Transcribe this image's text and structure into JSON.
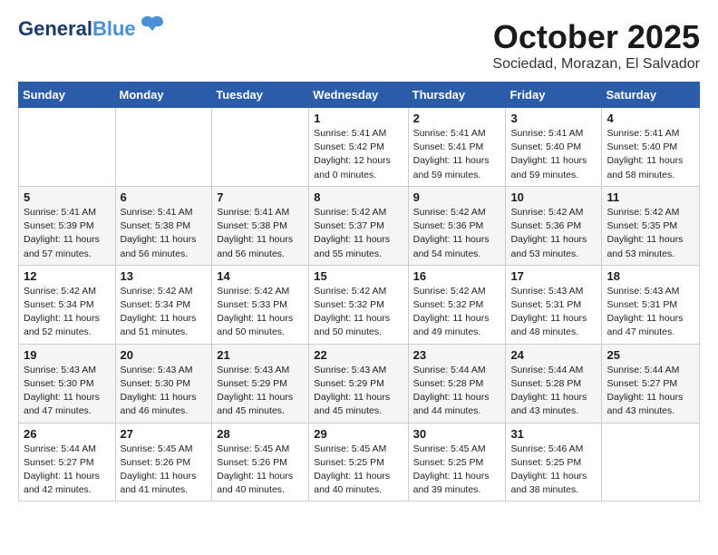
{
  "header": {
    "logo_line1": "General",
    "logo_line2": "Blue",
    "month": "October 2025",
    "location": "Sociedad, Morazan, El Salvador"
  },
  "weekdays": [
    "Sunday",
    "Monday",
    "Tuesday",
    "Wednesday",
    "Thursday",
    "Friday",
    "Saturday"
  ],
  "weeks": [
    [
      {
        "day": "",
        "info": ""
      },
      {
        "day": "",
        "info": ""
      },
      {
        "day": "",
        "info": ""
      },
      {
        "day": "1",
        "info": "Sunrise: 5:41 AM\nSunset: 5:42 PM\nDaylight: 12 hours\nand 0 minutes."
      },
      {
        "day": "2",
        "info": "Sunrise: 5:41 AM\nSunset: 5:41 PM\nDaylight: 11 hours\nand 59 minutes."
      },
      {
        "day": "3",
        "info": "Sunrise: 5:41 AM\nSunset: 5:40 PM\nDaylight: 11 hours\nand 59 minutes."
      },
      {
        "day": "4",
        "info": "Sunrise: 5:41 AM\nSunset: 5:40 PM\nDaylight: 11 hours\nand 58 minutes."
      }
    ],
    [
      {
        "day": "5",
        "info": "Sunrise: 5:41 AM\nSunset: 5:39 PM\nDaylight: 11 hours\nand 57 minutes."
      },
      {
        "day": "6",
        "info": "Sunrise: 5:41 AM\nSunset: 5:38 PM\nDaylight: 11 hours\nand 56 minutes."
      },
      {
        "day": "7",
        "info": "Sunrise: 5:41 AM\nSunset: 5:38 PM\nDaylight: 11 hours\nand 56 minutes."
      },
      {
        "day": "8",
        "info": "Sunrise: 5:42 AM\nSunset: 5:37 PM\nDaylight: 11 hours\nand 55 minutes."
      },
      {
        "day": "9",
        "info": "Sunrise: 5:42 AM\nSunset: 5:36 PM\nDaylight: 11 hours\nand 54 minutes."
      },
      {
        "day": "10",
        "info": "Sunrise: 5:42 AM\nSunset: 5:36 PM\nDaylight: 11 hours\nand 53 minutes."
      },
      {
        "day": "11",
        "info": "Sunrise: 5:42 AM\nSunset: 5:35 PM\nDaylight: 11 hours\nand 53 minutes."
      }
    ],
    [
      {
        "day": "12",
        "info": "Sunrise: 5:42 AM\nSunset: 5:34 PM\nDaylight: 11 hours\nand 52 minutes."
      },
      {
        "day": "13",
        "info": "Sunrise: 5:42 AM\nSunset: 5:34 PM\nDaylight: 11 hours\nand 51 minutes."
      },
      {
        "day": "14",
        "info": "Sunrise: 5:42 AM\nSunset: 5:33 PM\nDaylight: 11 hours\nand 50 minutes."
      },
      {
        "day": "15",
        "info": "Sunrise: 5:42 AM\nSunset: 5:32 PM\nDaylight: 11 hours\nand 50 minutes."
      },
      {
        "day": "16",
        "info": "Sunrise: 5:42 AM\nSunset: 5:32 PM\nDaylight: 11 hours\nand 49 minutes."
      },
      {
        "day": "17",
        "info": "Sunrise: 5:43 AM\nSunset: 5:31 PM\nDaylight: 11 hours\nand 48 minutes."
      },
      {
        "day": "18",
        "info": "Sunrise: 5:43 AM\nSunset: 5:31 PM\nDaylight: 11 hours\nand 47 minutes."
      }
    ],
    [
      {
        "day": "19",
        "info": "Sunrise: 5:43 AM\nSunset: 5:30 PM\nDaylight: 11 hours\nand 47 minutes."
      },
      {
        "day": "20",
        "info": "Sunrise: 5:43 AM\nSunset: 5:30 PM\nDaylight: 11 hours\nand 46 minutes."
      },
      {
        "day": "21",
        "info": "Sunrise: 5:43 AM\nSunset: 5:29 PM\nDaylight: 11 hours\nand 45 minutes."
      },
      {
        "day": "22",
        "info": "Sunrise: 5:43 AM\nSunset: 5:29 PM\nDaylight: 11 hours\nand 45 minutes."
      },
      {
        "day": "23",
        "info": "Sunrise: 5:44 AM\nSunset: 5:28 PM\nDaylight: 11 hours\nand 44 minutes."
      },
      {
        "day": "24",
        "info": "Sunrise: 5:44 AM\nSunset: 5:28 PM\nDaylight: 11 hours\nand 43 minutes."
      },
      {
        "day": "25",
        "info": "Sunrise: 5:44 AM\nSunset: 5:27 PM\nDaylight: 11 hours\nand 43 minutes."
      }
    ],
    [
      {
        "day": "26",
        "info": "Sunrise: 5:44 AM\nSunset: 5:27 PM\nDaylight: 11 hours\nand 42 minutes."
      },
      {
        "day": "27",
        "info": "Sunrise: 5:45 AM\nSunset: 5:26 PM\nDaylight: 11 hours\nand 41 minutes."
      },
      {
        "day": "28",
        "info": "Sunrise: 5:45 AM\nSunset: 5:26 PM\nDaylight: 11 hours\nand 40 minutes."
      },
      {
        "day": "29",
        "info": "Sunrise: 5:45 AM\nSunset: 5:25 PM\nDaylight: 11 hours\nand 40 minutes."
      },
      {
        "day": "30",
        "info": "Sunrise: 5:45 AM\nSunset: 5:25 PM\nDaylight: 11 hours\nand 39 minutes."
      },
      {
        "day": "31",
        "info": "Sunrise: 5:46 AM\nSunset: 5:25 PM\nDaylight: 11 hours\nand 38 minutes."
      },
      {
        "day": "",
        "info": ""
      }
    ]
  ]
}
